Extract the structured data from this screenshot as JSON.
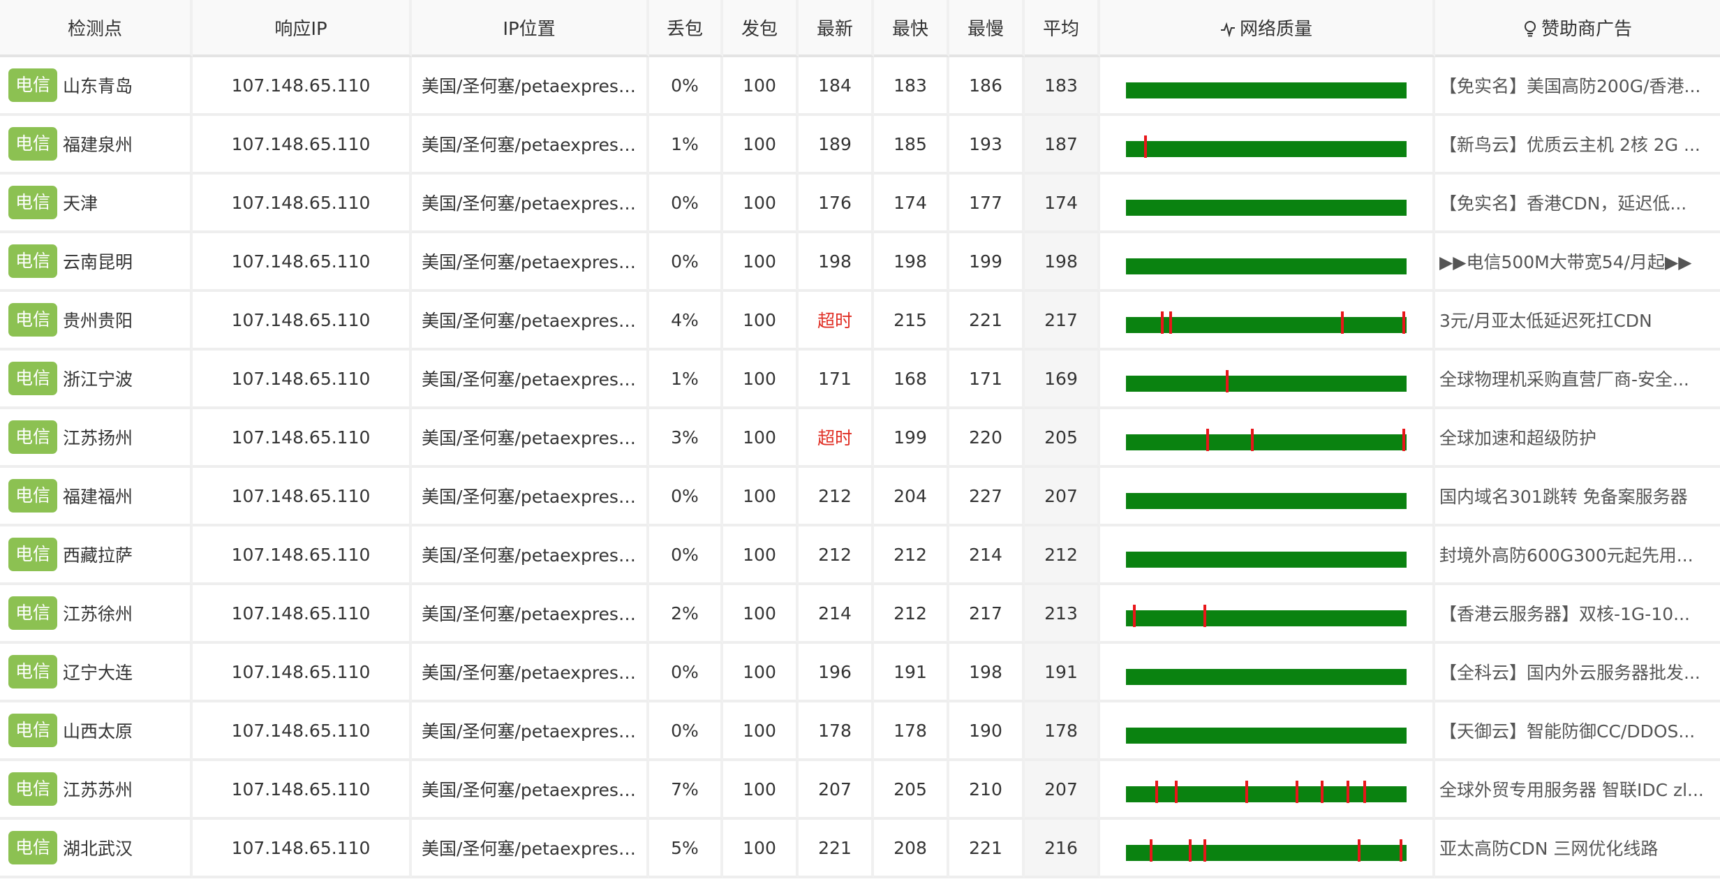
{
  "headers": {
    "node": "检测点",
    "ip": "响应IP",
    "location": "IP位置",
    "loss": "丢包",
    "sent": "发包",
    "latest": "最新",
    "fastest": "最快",
    "slowest": "最慢",
    "average": "平均",
    "quality": "网络质量",
    "ad": "赞助商广告"
  },
  "icons": {
    "quality": "pulse-icon",
    "ad": "lightbulb-icon"
  },
  "colors": {
    "isp_badge": "#8cc152",
    "quality_bar": "#0a8210",
    "loss_tick": "#e8161a",
    "timeout_text": "#e02e24"
  },
  "rows": [
    {
      "isp": "电信",
      "node": "山东青岛",
      "ip": "107.148.65.110",
      "location": "美国/圣何塞/petaexpress...",
      "loss": "0%",
      "sent": "100",
      "latest": "184",
      "fastest": "183",
      "slowest": "186",
      "average": "183",
      "ad": "【免实名】美国高防200G/香港...",
      "loss_marks": []
    },
    {
      "isp": "电信",
      "node": "福建泉州",
      "ip": "107.148.65.110",
      "location": "美国/圣何塞/petaexpress...",
      "loss": "1%",
      "sent": "100",
      "latest": "189",
      "fastest": "185",
      "slowest": "193",
      "average": "187",
      "ad": "【新鸟云】优质云主机 2核 2G ...",
      "loss_marks": [
        0.07
      ]
    },
    {
      "isp": "电信",
      "node": "天津",
      "ip": "107.148.65.110",
      "location": "美国/圣何塞/petaexpress...",
      "loss": "0%",
      "sent": "100",
      "latest": "176",
      "fastest": "174",
      "slowest": "177",
      "average": "174",
      "ad": "【免实名】香港CDN，延迟低...",
      "loss_marks": []
    },
    {
      "isp": "电信",
      "node": "云南昆明",
      "ip": "107.148.65.110",
      "location": "美国/圣何塞/petaexpress...",
      "loss": "0%",
      "sent": "100",
      "latest": "198",
      "fastest": "198",
      "slowest": "199",
      "average": "198",
      "ad": "▶▶电信500M大带宽54/月起▶▶",
      "loss_marks": []
    },
    {
      "isp": "电信",
      "node": "贵州贵阳",
      "ip": "107.148.65.110",
      "location": "美国/圣何塞/petaexpress...",
      "loss": "4%",
      "sent": "100",
      "latest": "超时",
      "latest_timeout": true,
      "fastest": "215",
      "slowest": "221",
      "average": "217",
      "ad": "3元/月亚太低延迟死扛CDN",
      "loss_marks": [
        0.13,
        0.16,
        0.77,
        0.99
      ]
    },
    {
      "isp": "电信",
      "node": "浙江宁波",
      "ip": "107.148.65.110",
      "location": "美国/圣何塞/petaexpress...",
      "loss": "1%",
      "sent": "100",
      "latest": "171",
      "fastest": "168",
      "slowest": "171",
      "average": "169",
      "ad": "全球物理机采购直营厂商-安全...",
      "loss_marks": [
        0.36
      ]
    },
    {
      "isp": "电信",
      "node": "江苏扬州",
      "ip": "107.148.65.110",
      "location": "美国/圣何塞/petaexpress...",
      "loss": "3%",
      "sent": "100",
      "latest": "超时",
      "latest_timeout": true,
      "fastest": "199",
      "slowest": "220",
      "average": "205",
      "ad": "全球加速和超级防护",
      "loss_marks": [
        0.29,
        0.45,
        0.99
      ]
    },
    {
      "isp": "电信",
      "node": "福建福州",
      "ip": "107.148.65.110",
      "location": "美国/圣何塞/petaexpress...",
      "loss": "0%",
      "sent": "100",
      "latest": "212",
      "fastest": "204",
      "slowest": "227",
      "average": "207",
      "ad": "国内域名301跳转 免备案服务器",
      "loss_marks": []
    },
    {
      "isp": "电信",
      "node": "西藏拉萨",
      "ip": "107.148.65.110",
      "location": "美国/圣何塞/petaexpress...",
      "loss": "0%",
      "sent": "100",
      "latest": "212",
      "fastest": "212",
      "slowest": "214",
      "average": "212",
      "ad": "封境外高防600G300元起先用...",
      "loss_marks": []
    },
    {
      "isp": "电信",
      "node": "江苏徐州",
      "ip": "107.148.65.110",
      "location": "美国/圣何塞/petaexpress...",
      "loss": "2%",
      "sent": "100",
      "latest": "214",
      "fastest": "212",
      "slowest": "217",
      "average": "213",
      "ad": "【香港云服务器】双核-1G-10...",
      "loss_marks": [
        0.03,
        0.28
      ]
    },
    {
      "isp": "电信",
      "node": "辽宁大连",
      "ip": "107.148.65.110",
      "location": "美国/圣何塞/petaexpress...",
      "loss": "0%",
      "sent": "100",
      "latest": "196",
      "fastest": "191",
      "slowest": "198",
      "average": "191",
      "ad": "【全科云】国内外云服务器批发...",
      "loss_marks": []
    },
    {
      "isp": "电信",
      "node": "山西太原",
      "ip": "107.148.65.110",
      "location": "美国/圣何塞/petaexpress...",
      "loss": "0%",
      "sent": "100",
      "latest": "178",
      "fastest": "178",
      "slowest": "190",
      "average": "178",
      "ad": "【天御云】智能防御CC/DDOS...",
      "loss_marks": []
    },
    {
      "isp": "电信",
      "node": "江苏苏州",
      "ip": "107.148.65.110",
      "location": "美国/圣何塞/petaexpress...",
      "loss": "7%",
      "sent": "100",
      "latest": "207",
      "fastest": "205",
      "slowest": "210",
      "average": "207",
      "ad": "全球外贸专用服务器 智联IDC zl...",
      "loss_marks": [
        0.11,
        0.18,
        0.43,
        0.61,
        0.7,
        0.79,
        0.85
      ]
    },
    {
      "isp": "电信",
      "node": "湖北武汉",
      "ip": "107.148.65.110",
      "location": "美国/圣何塞/petaexpress...",
      "loss": "5%",
      "sent": "100",
      "latest": "221",
      "fastest": "208",
      "slowest": "221",
      "average": "216",
      "ad": "亚太高防CDN 三网优化线路",
      "loss_marks": [
        0.09,
        0.23,
        0.28,
        0.83,
        0.98
      ]
    }
  ]
}
